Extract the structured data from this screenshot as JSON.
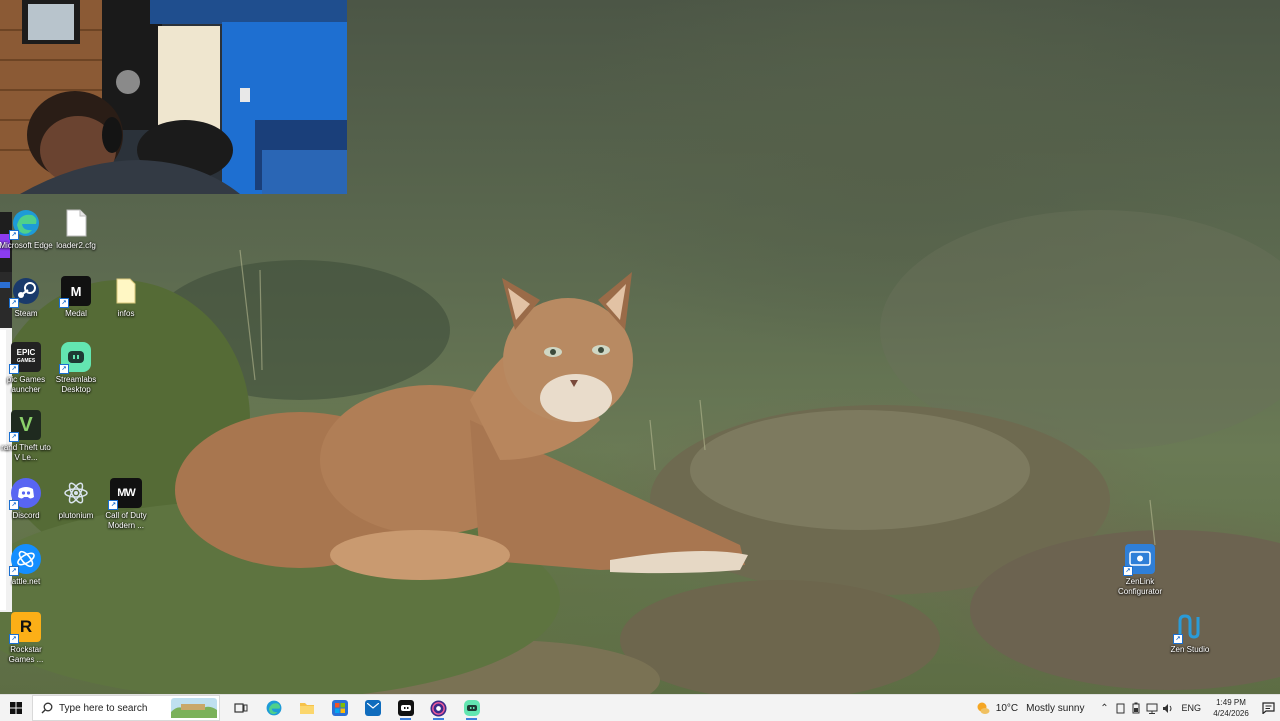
{
  "desktop_icons": [
    {
      "name": "microsoft-edge",
      "label": "Microsoft Edge",
      "icon": "edge-icon"
    },
    {
      "name": "loader-cfg",
      "label": "loader2.cfg",
      "icon": "file-icon"
    },
    {
      "name": "steam",
      "label": "Steam",
      "icon": "steam-icon"
    },
    {
      "name": "medal",
      "label": "Medal",
      "icon": "medal-icon"
    },
    {
      "name": "infos",
      "label": "infos",
      "icon": "folder-icon"
    },
    {
      "name": "epic-games",
      "label": "pic Games auncher",
      "icon": "epic-games-icon"
    },
    {
      "name": "streamlabs",
      "label": "Streamlabs Desktop",
      "icon": "streamlabs-icon"
    },
    {
      "name": "gta-v",
      "label": "rand Theft uto V Le...",
      "icon": "gta-v-icon"
    },
    {
      "name": "discord",
      "label": "Discord",
      "icon": "discord-icon"
    },
    {
      "name": "plutonium",
      "label": "plutonium",
      "icon": "plutonium-icon"
    },
    {
      "name": "call-of-duty",
      "label": "Call of Duty Modern ...",
      "icon": "mw-icon"
    },
    {
      "name": "battle-net",
      "label": "attle.net",
      "icon": "battle-net-icon"
    },
    {
      "name": "rockstar",
      "label": "Rockstar Games ...",
      "icon": "rockstar-icon"
    },
    {
      "name": "zenlink",
      "label": "ZenLink Configurator",
      "icon": "zenlink-icon"
    },
    {
      "name": "zen-studio",
      "label": "Zen Studio",
      "icon": "zen-studio-icon"
    }
  ],
  "icon_text": {
    "epic": "EPIC",
    "epic_sub": "GAMES",
    "medal": "M",
    "mw": "MW",
    "rockstar": "R",
    "gta": "V"
  },
  "taskbar": {
    "search_placeholder": "Type here to search",
    "apps": [
      "task-view-icon",
      "edge-icon",
      "file-explorer-icon",
      "store-icon",
      "outlook-icon",
      "medal-icon",
      "obs-icon",
      "streamlabs-icon"
    ]
  },
  "tray": {
    "temperature": "10°C",
    "weather": "Mostly sunny",
    "language": "ENG",
    "time": "1:49 PM",
    "date": "4/24/2026"
  },
  "colors": {
    "taskbar": "#f3f3f3",
    "accent": "#3d7edb"
  }
}
